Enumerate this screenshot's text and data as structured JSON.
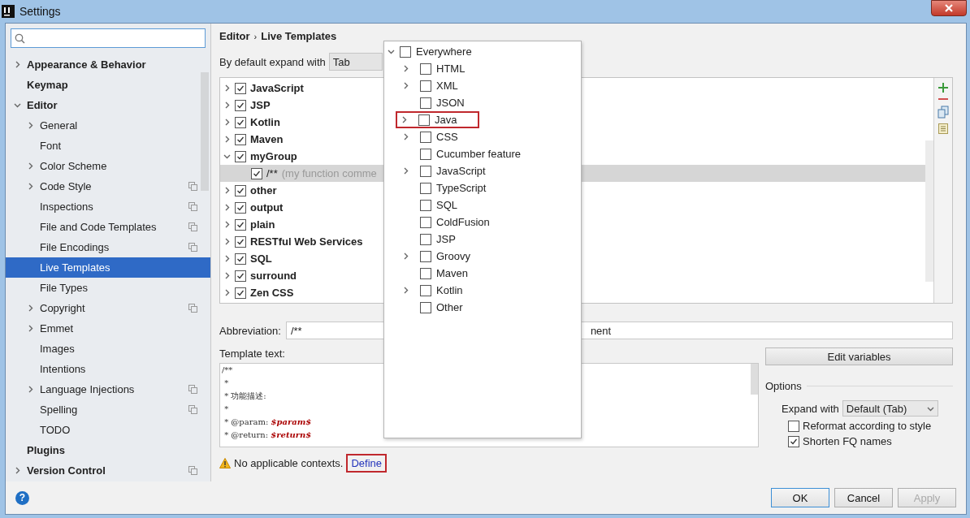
{
  "window": {
    "title": "Settings"
  },
  "sidebar": {
    "items": [
      {
        "label": "Appearance & Behavior",
        "expanded": false,
        "selected": false
      },
      {
        "label": "Keymap",
        "selected": false
      },
      {
        "label": "Editor",
        "expanded": true,
        "selected": false,
        "children": [
          {
            "label": "General",
            "expanded": false,
            "selected": false
          },
          {
            "label": "Font",
            "selected": false
          },
          {
            "label": "Color Scheme",
            "expanded": false,
            "selected": false
          },
          {
            "label": "Code Style",
            "expanded": false,
            "selected": false,
            "project_scope": true
          },
          {
            "label": "Inspections",
            "selected": false,
            "project_scope": true
          },
          {
            "label": "File and Code Templates",
            "selected": false,
            "project_scope": true
          },
          {
            "label": "File Encodings",
            "selected": false,
            "project_scope": true
          },
          {
            "label": "Live Templates",
            "selected": true
          },
          {
            "label": "File Types",
            "selected": false
          },
          {
            "label": "Copyright",
            "expanded": false,
            "selected": false,
            "project_scope": true
          },
          {
            "label": "Emmet",
            "expanded": false,
            "selected": false
          },
          {
            "label": "Images",
            "selected": false
          },
          {
            "label": "Intentions",
            "selected": false
          },
          {
            "label": "Language Injections",
            "expanded": false,
            "selected": false,
            "project_scope": true
          },
          {
            "label": "Spelling",
            "selected": false,
            "project_scope": true
          },
          {
            "label": "TODO",
            "selected": false
          }
        ]
      },
      {
        "label": "Plugins",
        "selected": false
      },
      {
        "label": "Version Control",
        "expanded": false,
        "selected": false,
        "project_scope": true
      }
    ]
  },
  "breadcrumb": [
    "Editor",
    "›",
    "Live Templates"
  ],
  "expand_default": {
    "label": "By default expand with",
    "value": "Tab"
  },
  "template_groups": [
    {
      "name": "JavaScript",
      "checked": true,
      "expanded": false
    },
    {
      "name": "JSP",
      "checked": true,
      "expanded": false
    },
    {
      "name": "Kotlin",
      "checked": true,
      "expanded": false
    },
    {
      "name": "Maven",
      "checked": true,
      "expanded": false
    },
    {
      "name": "myGroup",
      "checked": true,
      "expanded": true,
      "children": [
        {
          "abbreviation": "/**",
          "description": "(my function comme",
          "checked": true,
          "selected": true
        }
      ]
    },
    {
      "name": "other",
      "checked": true,
      "expanded": false
    },
    {
      "name": "output",
      "checked": true,
      "expanded": false
    },
    {
      "name": "plain",
      "checked": true,
      "expanded": false
    },
    {
      "name": "RESTful Web Services",
      "checked": true,
      "expanded": false
    },
    {
      "name": "SQL",
      "checked": true,
      "expanded": false
    },
    {
      "name": "surround",
      "checked": true,
      "expanded": false
    },
    {
      "name": "Zen CSS",
      "checked": true,
      "expanded": false
    }
  ],
  "abbreviation": {
    "label": "Abbreviation:",
    "value": "/**"
  },
  "description": {
    "value": "nent"
  },
  "template_text": {
    "label": "Template text:",
    "lines": [
      {
        "text": "/**"
      },
      {
        "text": " *"
      },
      {
        "text": " * 功能描述:"
      },
      {
        "text": " *"
      },
      {
        "text": " * @param:",
        "variable": "$param$"
      },
      {
        "text": " * @return:",
        "variable": "$return$"
      }
    ]
  },
  "context_warning": {
    "text": "No applicable contexts.",
    "link": "Define",
    "highlighted": true
  },
  "edit_variables": "Edit variables",
  "options": {
    "title": "Options",
    "expand_with": {
      "label": "Expand with",
      "value": "Default (Tab)"
    },
    "checkboxes": [
      {
        "label": "Reformat according to style",
        "checked": false
      },
      {
        "label": "Shorten FQ names",
        "checked": true
      }
    ]
  },
  "context_popup": {
    "root": {
      "label": "Everywhere",
      "checked": false,
      "expanded": true
    },
    "items": [
      {
        "label": "HTML",
        "checked": false,
        "expanded": false,
        "highlighted": false
      },
      {
        "label": "XML",
        "checked": false,
        "expanded": false,
        "highlighted": false
      },
      {
        "label": "JSON",
        "checked": false,
        "highlighted": false
      },
      {
        "label": "Java",
        "checked": false,
        "expanded": false,
        "highlighted": true
      },
      {
        "label": "CSS",
        "checked": false,
        "expanded": false,
        "highlighted": false
      },
      {
        "label": "Cucumber feature",
        "checked": false,
        "highlighted": false
      },
      {
        "label": "JavaScript",
        "checked": false,
        "expanded": false,
        "highlighted": false
      },
      {
        "label": "TypeScript",
        "checked": false,
        "highlighted": false
      },
      {
        "label": "SQL",
        "checked": false,
        "highlighted": false
      },
      {
        "label": "ColdFusion",
        "checked": false,
        "highlighted": false
      },
      {
        "label": "JSP",
        "checked": false,
        "highlighted": false
      },
      {
        "label": "Groovy",
        "checked": false,
        "expanded": false,
        "highlighted": false
      },
      {
        "label": "Maven",
        "checked": false,
        "highlighted": false
      },
      {
        "label": "Kotlin",
        "checked": false,
        "expanded": false,
        "highlighted": false
      },
      {
        "label": "Other",
        "checked": false,
        "highlighted": false
      }
    ]
  },
  "footer": {
    "help": "?",
    "buttons": [
      {
        "label": "OK",
        "default": true,
        "disabled": false
      },
      {
        "label": "Cancel",
        "default": false,
        "disabled": false
      },
      {
        "label": "Apply",
        "default": false,
        "disabled": true
      }
    ]
  }
}
